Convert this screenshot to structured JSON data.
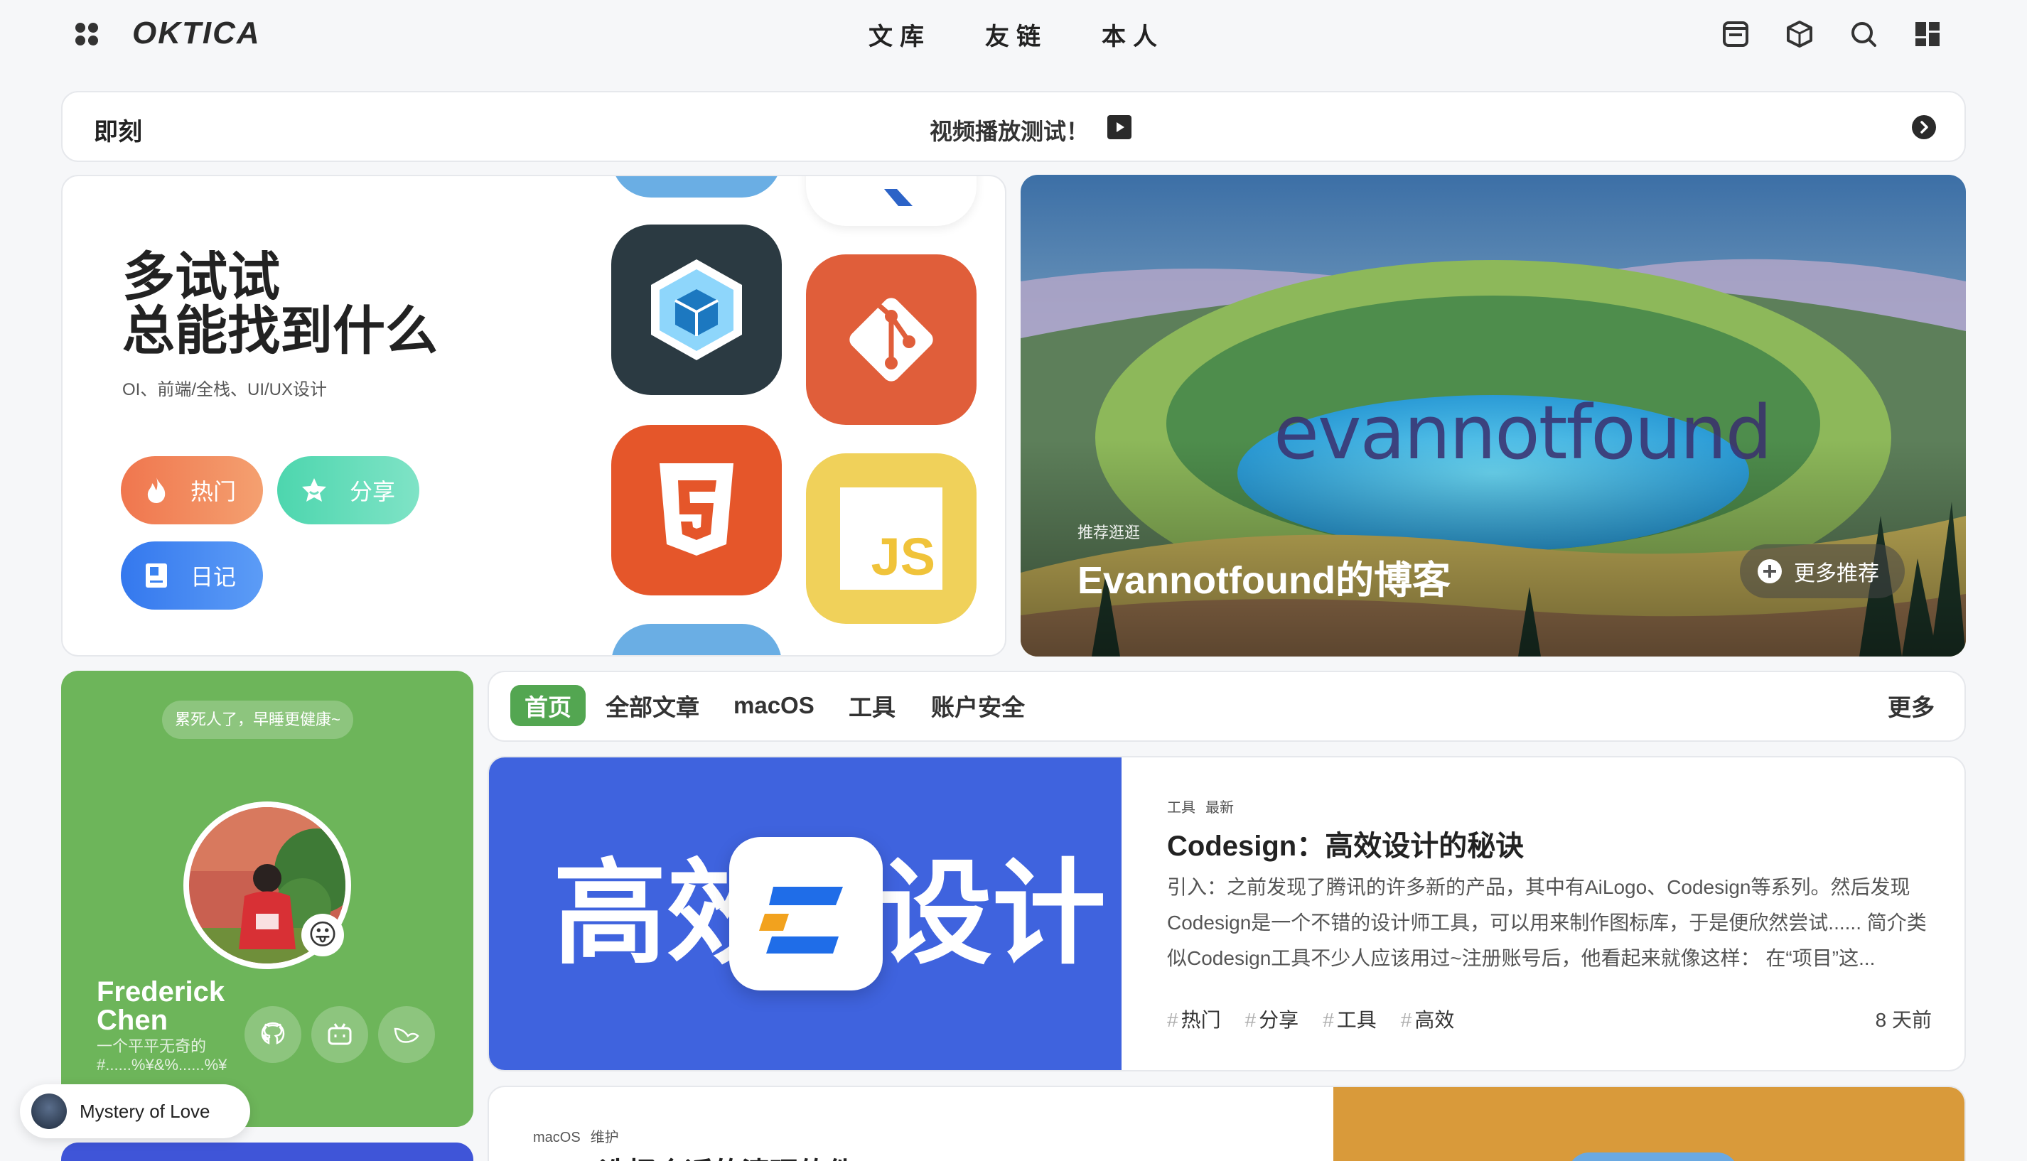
{
  "header": {
    "logo_text": "OKTICA",
    "nav": [
      {
        "label": "文库"
      },
      {
        "label": "友链"
      },
      {
        "label": "本人"
      }
    ],
    "icons": [
      "inbox-icon",
      "cube-icon",
      "search-icon",
      "dashboard-icon"
    ]
  },
  "ticker": {
    "label": "即刻",
    "text": "视频播放测试！"
  },
  "hero": {
    "title_line1": "多试试",
    "title_line2": "总能找到什么",
    "subtitle": "OI、前端/全栈、UI/UX设计",
    "buttons": [
      {
        "label": "热门",
        "icon": "flame-icon",
        "color": "#f08a58"
      },
      {
        "label": "分享",
        "icon": "star-badge-icon",
        "color": "#5dd8b4"
      },
      {
        "label": "日记",
        "icon": "book-icon",
        "color": "#3a82f0"
      }
    ],
    "tiles": [
      {
        "name": "webpack",
        "color": "#2b3a42"
      },
      {
        "name": "git",
        "color": "#e05e3a"
      },
      {
        "name": "html5",
        "color": "#e5562a"
      },
      {
        "name": "js",
        "color": "#f0d15a",
        "text": "JS"
      }
    ]
  },
  "featured": {
    "watermark": "evannotfound",
    "label": "推荐逛逛",
    "title": "Evannotfound的博客",
    "more_label": "更多推荐"
  },
  "profile": {
    "status": "累死人了，早睡更健康~",
    "name_line1": "Frederick",
    "name_line2": "Chen",
    "bio": "一个平平无奇的#......%¥&%......%¥",
    "avatar_badge": "😛",
    "socials": [
      "github-icon",
      "bilibili-icon",
      "bird-icon"
    ]
  },
  "music": {
    "title": "Mystery of Love"
  },
  "categories": {
    "tabs": [
      "首页",
      "全部文章",
      "macOS",
      "工具",
      "账户安全"
    ],
    "active": 0,
    "more_label": "更多"
  },
  "posts": [
    {
      "cover_text_left": "高效",
      "cover_text_right": "设计",
      "cats": [
        "工具",
        "最新"
      ],
      "title": "Codesign：高效设计的秘诀",
      "excerpt": "引入：之前发现了腾讯的许多新的产品，其中有AiLogo、Codesign等系列。然后发现Codesign是一个不错的设计师工具，可以用来制作图标库，于是便欣然尝试...... 简介类似Codesign工具不少人应该用过~注册账号后，他看起来就像这样： 在“项目”这...",
      "tags": [
        "热门",
        "分享",
        "工具",
        "高效"
      ],
      "time": "8 天前"
    },
    {
      "cats": [
        "macOS",
        "维护"
      ],
      "title": "CC - 选择合适的清理软件"
    }
  ],
  "colors": {
    "accent_green": "#53a651",
    "profile_green": "#6db55a",
    "post_cover_blue": "#3f63de",
    "post2_cover": "#d99a3a"
  }
}
